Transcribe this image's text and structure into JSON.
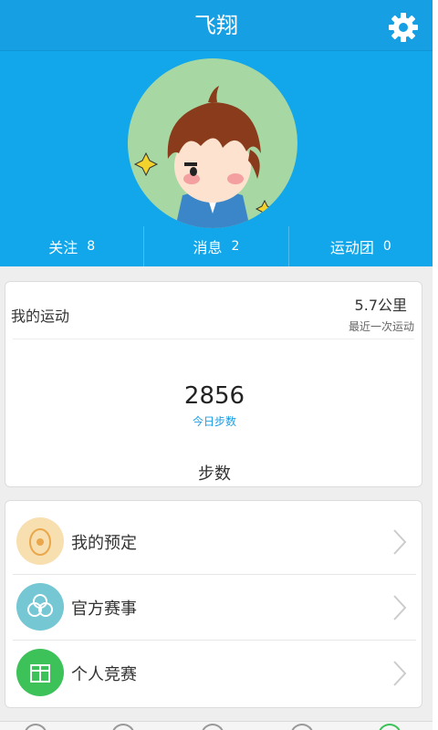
{
  "header": {
    "title": "飞翔",
    "settings_icon": "gear-icon",
    "background_color": "#12a6ea"
  },
  "profile": {
    "avatar": "cartoon-avatar-boy"
  },
  "stats": [
    {
      "label": "关注",
      "value": "8"
    },
    {
      "label": "消息",
      "value": "2"
    },
    {
      "label": "运动团",
      "value": "0"
    }
  ],
  "sport_card": {
    "title": "我的运动",
    "distance": "5.7公里",
    "distance_note": "最近一次运动",
    "steps": "2856",
    "steps_label": "今日步数",
    "section_title": "步数"
  },
  "menu": [
    {
      "label": "我的预定",
      "icon": "egg-icon",
      "color": "#f8dfb0"
    },
    {
      "label": "官方赛事",
      "icon": "flower-icon",
      "color": "#74c7d3"
    },
    {
      "label": "个人竞赛",
      "icon": "gift-icon",
      "color": "#3dc25a"
    }
  ]
}
